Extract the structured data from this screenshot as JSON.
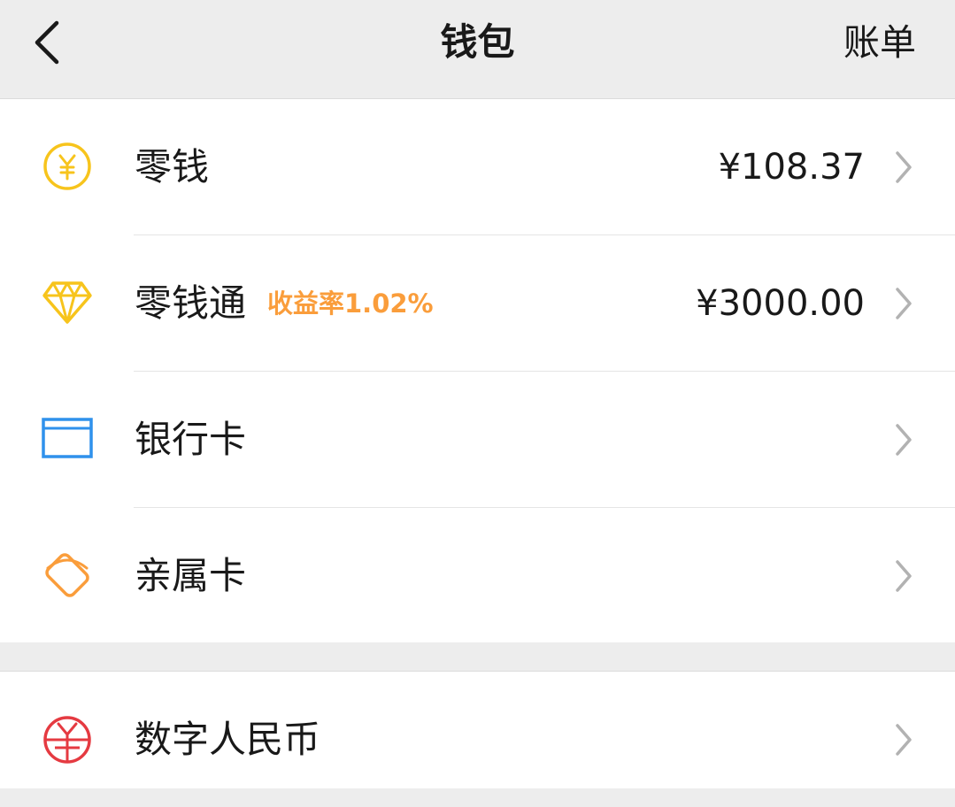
{
  "nav": {
    "back_icon": "chevron-left-icon",
    "title": "钱包",
    "right_action": "账单"
  },
  "wallet_items": [
    {
      "label": "零钱",
      "amount": "¥108.37",
      "icon": "yuan-coin-icon",
      "icon_color": "#f7c41c"
    },
    {
      "label": "零钱通",
      "tag": "收益率1.02%",
      "amount": "¥3000.00",
      "icon": "diamond-icon",
      "icon_color": "#f7c41c"
    },
    {
      "label": "银行卡",
      "icon": "bank-card-icon",
      "icon_color": "#2f91ec"
    },
    {
      "label": "亲属卡",
      "icon": "family-card-icon",
      "icon_color": "#fa9d3b"
    }
  ],
  "digital_rmb": {
    "label": "数字人民币",
    "icon": "digital-rmb-icon",
    "icon_color": "#e53a41"
  },
  "colors": {
    "background": "#ededed",
    "card": "#ffffff",
    "tag_orange": "#fa9d3b",
    "text": "#191919",
    "chevron": "#b2b2b2"
  }
}
